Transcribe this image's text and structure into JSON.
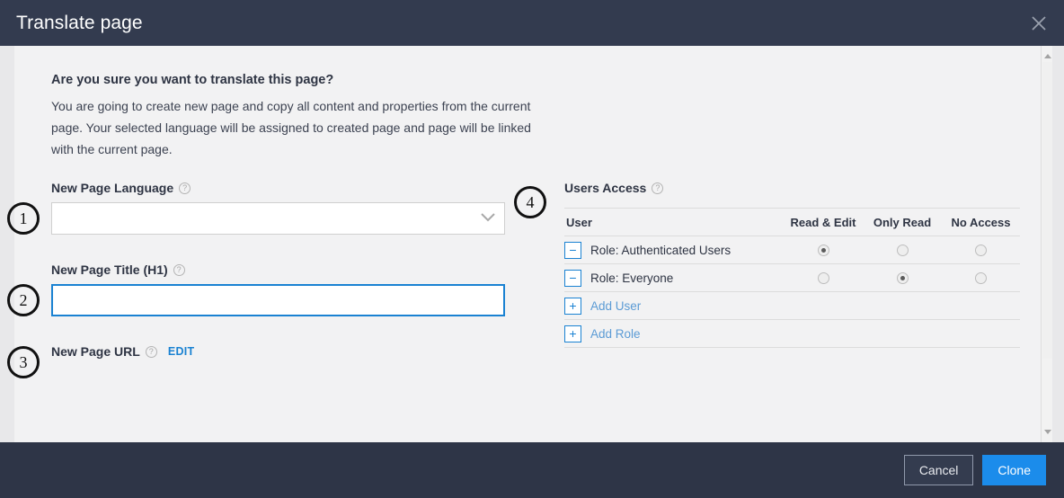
{
  "header": {
    "title": "Translate page",
    "close_icon": "close-icon"
  },
  "intro": {
    "heading": "Are you sure you want to translate this page?",
    "text": "You are going to create new page and copy all content and properties from the current page. Your selected language will be assigned to created page and page will be linked with the current page."
  },
  "callouts": {
    "one": "1",
    "two": "2",
    "three": "3",
    "four": "4"
  },
  "form": {
    "help_glyph": "?",
    "language": {
      "label": "New Page Language",
      "value": "",
      "placeholder": "",
      "chevron_icon": "chevron-down-icon"
    },
    "title": {
      "label": "New Page Title (H1)",
      "value": "",
      "placeholder": ""
    },
    "url": {
      "label": "New Page URL",
      "edit_label": "EDIT"
    }
  },
  "users_access": {
    "title": "Users Access",
    "columns": [
      "User",
      "Read & Edit",
      "Only Read",
      "No Access"
    ],
    "rows": [
      {
        "toggle_glyph": "−",
        "name": "Role: Authenticated Users",
        "selected": "Read & Edit"
      },
      {
        "toggle_glyph": "−",
        "name": "Role: Everyone",
        "selected": "Only Read"
      }
    ],
    "actions": [
      {
        "glyph": "+",
        "label": "Add User"
      },
      {
        "glyph": "+",
        "label": "Add Role"
      }
    ]
  },
  "footer": {
    "cancel_label": "Cancel",
    "clone_label": "Clone"
  },
  "colors": {
    "header_bg": "#333b4f",
    "footer_bg": "#2e3547",
    "accent_blue": "#1a82d2",
    "primary_button": "#1b8ceb",
    "body_bg": "#f2f2f3"
  }
}
